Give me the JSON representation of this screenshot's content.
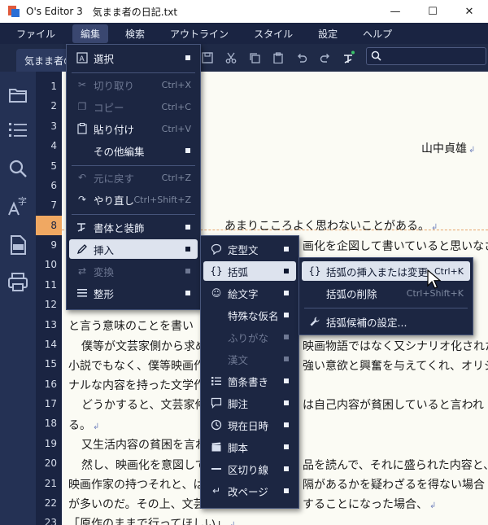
{
  "window": {
    "app_title": "O's Editor 3",
    "file_name": "気まま者の日記.txt",
    "minimize": "—",
    "maximize": "☐",
    "close": "✕"
  },
  "menubar": {
    "items": [
      "ファイル",
      "編集",
      "検索",
      "アウトライン",
      "スタイル",
      "設定",
      "ヘルプ"
    ],
    "active": "編集"
  },
  "tab": {
    "label": "気まま者の日記.txt"
  },
  "toolbar": {
    "icons": [
      "save-icon",
      "cut-icon",
      "copy-icon",
      "paste-icon",
      "undo-icon",
      "redo-icon",
      "style-icon",
      "search-icon"
    ]
  },
  "sidebar": {
    "icons": [
      "folder-icon",
      "outline-list-icon",
      "search-icon",
      "font-icon",
      "pdf-icon",
      "print-icon"
    ]
  },
  "gutter": {
    "lines": [
      "1",
      "2",
      "3",
      "4",
      "5",
      "6",
      "7",
      "8",
      "9",
      "10",
      "11",
      "12",
      "13",
      "14",
      "15",
      "16",
      "17",
      "18",
      "19",
      "20",
      "21",
      "22",
      "23"
    ],
    "current_line": "8"
  },
  "editor": {
    "author": "山中貞雄",
    "line8": "あまりこころよく思わないことがある。",
    "line9": "画化を企図して書いていると思いなさ",
    "line12": "と言う意味のことを書い",
    "line13a": "僕等が文芸家側から求め",
    "line13b": "映画物語ではなく又シナリオ化された",
    "line14a": "小説でもなく、僕等映画作",
    "line14b": "強い意欲と興奮を与えてくれ、オリジ",
    "line15": "ナルな内容を持った文学作",
    "line16a": "どうかすると、文芸家仲",
    "line16b": "は自己内容が貧困していると言われ",
    "line17": "る。",
    "line18": "又生活内容の貧困を言わ",
    "line19a": "然し、映画化を意図して",
    "line19b": "品を読んで、それに盛られた内容と、",
    "line20a": "映画作家の持つそれと、は",
    "line20b": "隔があるかを疑わざるを得ない場合",
    "line21a": "が多いのだ。その上、文芸",
    "line21b": "することになった場合、",
    "line22": "「原作のままで行ってほしい」"
  },
  "edit_menu": {
    "select": "選択",
    "cut": "切り取り",
    "cut_sc": "Ctrl+X",
    "copy": "コピー",
    "copy_sc": "Ctrl+C",
    "paste": "貼り付け",
    "paste_sc": "Ctrl+V",
    "other": "その他編集",
    "undo": "元に戻す",
    "undo_sc": "Ctrl+Z",
    "redo": "やり直し",
    "redo_sc": "Ctrl+Shift+Z",
    "format": "書体と装飾",
    "insert": "挿入",
    "convert": "変換",
    "arrange": "整形"
  },
  "insert_menu": {
    "template": "定型文",
    "brackets": "括弧",
    "emoji": "絵文字",
    "kana": "特殊な仮名",
    "furigana": "ふりがな",
    "kanji": "漢文",
    "bullets": "箇条書き",
    "footnote": "脚注",
    "datetime": "現在日時",
    "script": "脚本",
    "divider": "区切り線",
    "pagebreak": "改ページ"
  },
  "bracket_menu": {
    "insert_change": "括弧の挿入または変更",
    "insert_change_sc": "Ctrl+K",
    "delete": "括弧の削除",
    "delete_sc": "Ctrl+Shift+K",
    "settings": "括弧候補の設定..."
  },
  "colors": {
    "background": "#1f2a47",
    "editor_paper": "#fbfbf4",
    "current_line": "#f0a862",
    "menu_bg": "#1c2642",
    "menu_highlight": "#dde3ee"
  }
}
